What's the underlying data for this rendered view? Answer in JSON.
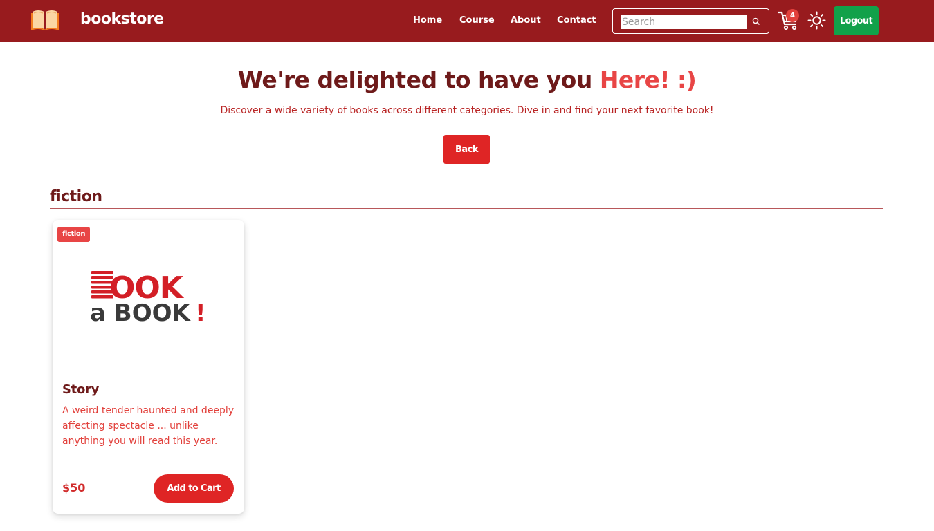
{
  "nav": {
    "brand": "bookstore",
    "links": [
      "Home",
      "Course",
      "About",
      "Contact"
    ],
    "search_placeholder": "Search",
    "cart_count": "4",
    "logout_label": "Logout"
  },
  "hero": {
    "title_main": "We're delighted to have you ",
    "title_accent": "Here! :)",
    "subtitle": "Discover a wide variety of books across different categories. Dive in and find your next favorite book!",
    "back_label": "Back"
  },
  "section": {
    "title": "fiction"
  },
  "book": {
    "tag": "fiction",
    "image_text_top": "BOOK",
    "image_text_bottom": "a BOOK!",
    "title": "Story",
    "description": "A weird tender haunted and deeply affecting spectacle ... unlike anything you will read this year.",
    "price": "$50",
    "add_label": "Add to Cart"
  },
  "colors": {
    "navbar": "#981b1e",
    "accent": "#e84545",
    "primary_button": "#df2525",
    "logout_button": "#12a14a",
    "heading": "#6e1a1a"
  },
  "icons": [
    "open-book-logo-icon",
    "search-icon",
    "cart-icon",
    "sun-icon"
  ]
}
